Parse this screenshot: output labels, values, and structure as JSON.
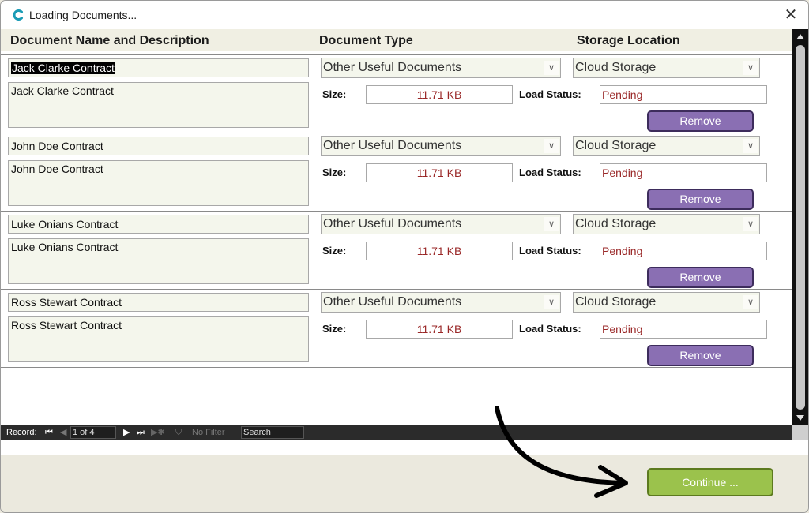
{
  "window": {
    "title": "Loading Documents..."
  },
  "headers": {
    "name": "Document Name and Description",
    "type": "Document Type",
    "location": "Storage Location"
  },
  "records": [
    {
      "name": "Jack Clarke Contract",
      "description": "Jack Clarke Contract",
      "type": "Other Useful Documents",
      "location": "Cloud Storage",
      "size_label": "Size:",
      "size": "11.71 KB",
      "status_label": "Load Status:",
      "status": "Pending",
      "remove": "Remove"
    },
    {
      "name": "John Doe Contract",
      "description": "John Doe Contract",
      "type": "Other Useful Documents",
      "location": "Cloud Storage",
      "size_label": "Size:",
      "size": "11.71 KB",
      "status_label": "Load Status:",
      "status": "Pending",
      "remove": "Remove"
    },
    {
      "name": "Luke Onians Contract",
      "description": "Luke Onians Contract",
      "type": "Other Useful Documents",
      "location": "Cloud Storage",
      "size_label": "Size:",
      "size": "11.71 KB",
      "status_label": "Load Status:",
      "status": "Pending",
      "remove": "Remove"
    },
    {
      "name": "Ross Stewart Contract",
      "description": "Ross Stewart Contract",
      "type": "Other Useful Documents",
      "location": "Cloud Storage",
      "size_label": "Size:",
      "size": "11.71 KB",
      "status_label": "Load Status:",
      "status": "Pending",
      "remove": "Remove"
    }
  ],
  "navigation": {
    "record_label": "Record:",
    "position": "1 of 4",
    "filter": "No Filter",
    "search": "Search"
  },
  "footer": {
    "continue": "Continue ..."
  },
  "colors": {
    "remove_button": "#8a6fb3",
    "continue_button": "#9bc24c",
    "status_text": "#9a2828",
    "field_bg": "#f4f6ec"
  }
}
